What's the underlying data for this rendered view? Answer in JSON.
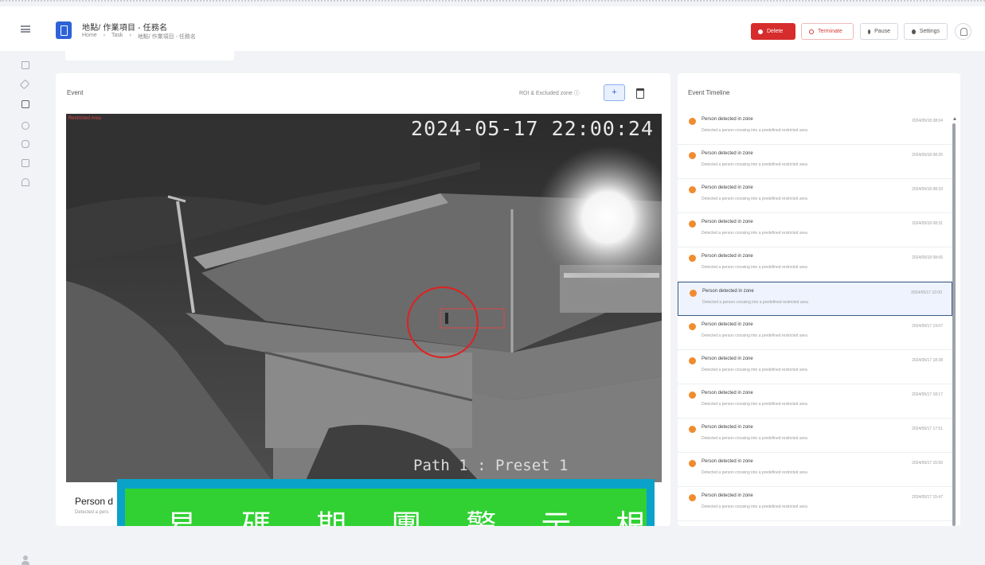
{
  "header": {
    "app_title": "地點/ 作業項目 - 任務名",
    "breadcrumbs": [
      "Home",
      "›",
      "Task",
      "›",
      "地點/ 作業項目 - 任務名"
    ],
    "buttons": {
      "delete": "Delete",
      "terminate": "Terminate",
      "pause": "Pause",
      "settings": "Settings"
    },
    "colors": {
      "accent": "#2d62d8",
      "danger": "#d62c2c"
    }
  },
  "sidebar": {
    "icons": [
      "home-icon",
      "tag-icon",
      "document-icon",
      "clock-icon",
      "database-icon",
      "grid-icon",
      "building-icon",
      "user-icon"
    ]
  },
  "event_panel": {
    "title": "Event",
    "roi_label": "ROI & Excluded zone ⓘ",
    "add_label": "+",
    "camera": {
      "top_label": "Restricted Area",
      "timestamp": "2024-05-17 22:00:24",
      "path_label": "Path 1 : Preset 1"
    },
    "info_title": "Person d",
    "info_sub": "Detected a pers"
  },
  "banner": {
    "text": "易 碼 期 團 警 示 根 示"
  },
  "timeline": {
    "title": "Event Timeline",
    "items": [
      {
        "name": "Person detected in zone",
        "desc": "Detected a person crossing into a predefined restricted area",
        "time": "2024/05/18 08:04",
        "selected": false
      },
      {
        "name": "Person detected in zone",
        "desc": "Detected a person crossing into a predefined restricted area",
        "time": "2024/05/18 08:25",
        "selected": false
      },
      {
        "name": "Person detected in zone",
        "desc": "Detected a person crossing into a predefined restricted area",
        "time": "2024/05/18 08:33",
        "selected": false
      },
      {
        "name": "Person detected in zone",
        "desc": "Detected a person crossing into a predefined restricted area",
        "time": "2024/05/18 08:31",
        "selected": false
      },
      {
        "name": "Person detected in zone",
        "desc": "Detected a person crossing into a predefined restricted area",
        "time": "2024/05/18 08:06",
        "selected": false
      },
      {
        "name": "Person detected in zone",
        "desc": "Detected a person crossing into a predefined restricted area",
        "time": "2024/05/17 22:00",
        "selected": true
      },
      {
        "name": "Person detected in zone",
        "desc": "Detected a person crossing into a predefined restricted area",
        "time": "2024/05/17 19:07",
        "selected": false
      },
      {
        "name": "Person detected in zone",
        "desc": "Detected a person crossing into a predefined restricted area",
        "time": "2024/05/17 18:38",
        "selected": false
      },
      {
        "name": "Person detected in zone",
        "desc": "Detected a person crossing into a predefined restricted area",
        "time": "2024/05/17 18:17",
        "selected": false
      },
      {
        "name": "Person detected in zone",
        "desc": "Detected a person crossing into a predefined restricted area",
        "time": "2024/05/17 17:51",
        "selected": false
      },
      {
        "name": "Person detected in zone",
        "desc": "Detected a person crossing into a predefined restricted area",
        "time": "2024/05/17 15:50",
        "selected": false
      },
      {
        "name": "Person detected in zone",
        "desc": "Detected a person crossing into a predefined restricted area",
        "time": "2024/05/17 15:47",
        "selected": false
      }
    ]
  }
}
